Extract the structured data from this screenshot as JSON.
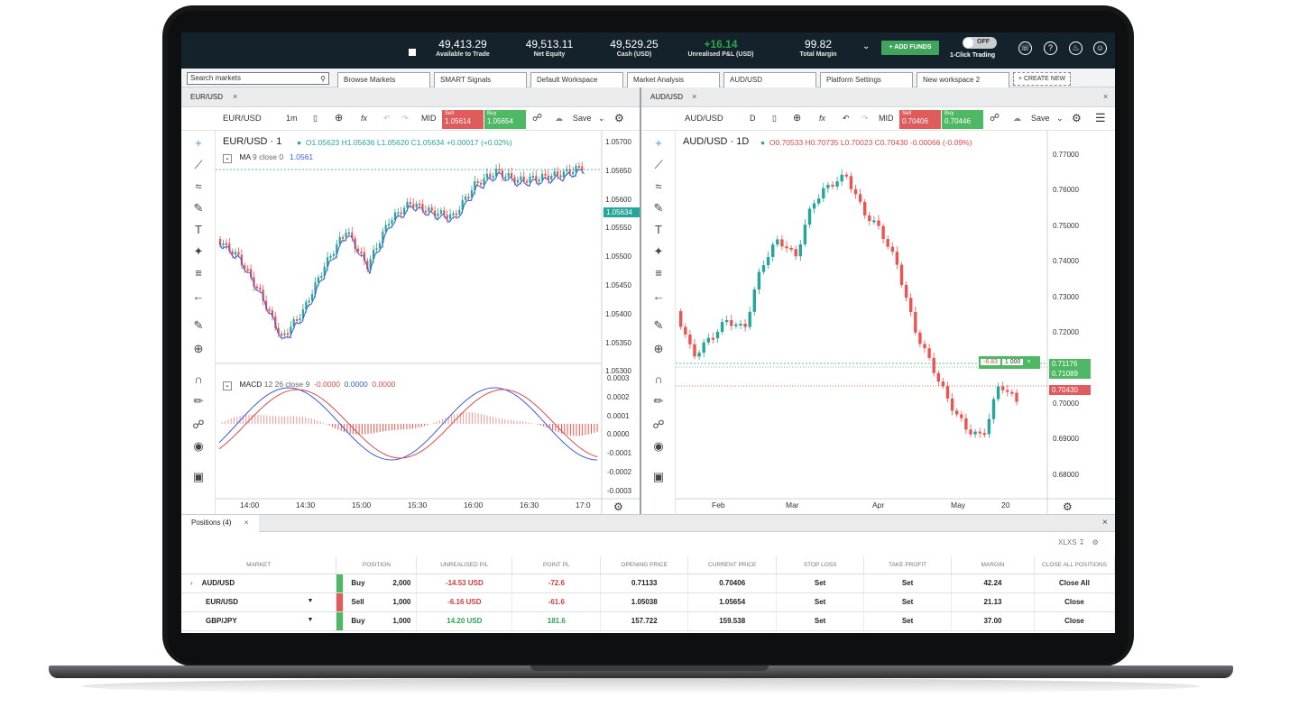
{
  "header": {
    "available_value": "49,413.29",
    "available_label": "Available to Trade",
    "net_value": "49,513.11",
    "net_label": "Net Equity",
    "cash_value": "49,529.25",
    "cash_label": "Cash (USD)",
    "pl_value": "+16.14",
    "pl_label": "Unrealised P&L (USD)",
    "margin_value": "99.82",
    "margin_label": "Total Margin",
    "add_funds": "+ ADD FUNDS",
    "toggle_state": "OFF",
    "toggle_label": "1-Click Trading",
    "icons": [
      "phone-icon",
      "help-icon",
      "bell-icon",
      "user-icon"
    ]
  },
  "workspace": {
    "search_placeholder": "Search markets",
    "tabs": [
      "Browse Markets",
      "SMART Signals",
      "Default Workspace",
      "Market Analysis",
      "AUD/USD",
      "Platform Settings",
      "New workspace 2"
    ],
    "create_new": "+ CREATE NEW"
  },
  "left_chart": {
    "tab": "EUR/USD",
    "toolbar": {
      "symbol": "EUR/USD",
      "interval": "1m",
      "mid": "MID",
      "sell_label": "Sell",
      "sell_price": "1.05614",
      "buy_label": "Buy",
      "buy_price": "1.05654",
      "save": "Save"
    },
    "title": "EUR/USD · 1",
    "o": "O1.05623",
    "h": "H1.05636",
    "l": "L1.05620",
    "c": "C1.05634",
    "chg": "+0.00017 (+0.02%)",
    "ma_label": "MA",
    "ma_params": "9 close 0",
    "ma_value": "1.0561",
    "macd_label": "MACD",
    "macd_params": "12 26 close 9",
    "macd_v1": "-0.0000",
    "macd_v2": "0.0000",
    "macd_v3": "0.0000",
    "y_ticks": [
      "1.05700",
      "1.05650",
      "1.05600",
      "1.05550",
      "1.05500",
      "1.05450",
      "1.05400",
      "1.05350",
      "1.05300"
    ],
    "price_tag": "1.05634",
    "macd_ticks": [
      "0.0003",
      "0.0002",
      "0.0001",
      "0.0000",
      "-0.0001",
      "-0.0002",
      "-0.0003"
    ],
    "x_ticks": [
      "14:00",
      "14:30",
      "15:00",
      "15:30",
      "16:00",
      "16:30",
      "17:0"
    ]
  },
  "right_chart": {
    "tab": "AUD/USD",
    "toolbar": {
      "symbol": "AUD/USD",
      "interval": "D",
      "mid": "MID",
      "sell_label": "Sell",
      "sell_price": "0.70406",
      "buy_label": "Buy",
      "buy_price": "0.70446",
      "save": "Save"
    },
    "title": "AUD/USD · 1D",
    "o": "O0.70533",
    "h": "H0.70735",
    "l": "L0.70023",
    "c": "C0.70430",
    "chg": "-0.00066 (-0.09%)",
    "y_ticks": [
      "0.77000",
      "0.76000",
      "0.75000",
      "0.74000",
      "0.73000",
      "0.72000",
      "0.71000",
      "0.70000",
      "0.69000",
      "0.68000"
    ],
    "tag_green1": "0.71176",
    "tag_green2": "0.71089",
    "tag_red": "0.70430",
    "pos_pl": "-6.83",
    "pos_size": "1 000",
    "x_ticks": [
      "Feb",
      "Mar",
      "Apr",
      "May",
      "20"
    ]
  },
  "positions": {
    "tab": "Positions (4)",
    "export": "XLXS",
    "columns": [
      "MARKET",
      "POSITION",
      "UNREALISED P/L",
      "POINT PL",
      "OPENING PRICE",
      "CURRENT PRICE",
      "STOP LOSS",
      "TAKE PROFIT",
      "MARGIN",
      "CLOSE ALL POSITIONS"
    ],
    "rows": [
      {
        "market": "AUD/USD",
        "side": "Buy",
        "size": "2,000",
        "upl": "-14.53 USD",
        "ppl": "-72.6",
        "open": "0.71133",
        "current": "0.70406",
        "sl": "Set",
        "tp": "Set",
        "margin": "42.24",
        "close": "Close All"
      },
      {
        "market": "EUR/USD",
        "side": "Sell",
        "size": "1,000",
        "upl": "-6.16 USD",
        "ppl": "-61.6",
        "open": "1.05038",
        "current": "1.05654",
        "sl": "Set",
        "tp": "Set",
        "margin": "21.13",
        "close": "Close"
      },
      {
        "market": "GBP/JPY",
        "side": "Buy",
        "size": "1,000",
        "upl": "14.20 USD",
        "ppl": "181.6",
        "open": "157.722",
        "current": "159.538",
        "sl": "Set",
        "tp": "Set",
        "margin": "37.00",
        "close": "Close"
      }
    ]
  },
  "colors": {
    "header_bg": "#14232b",
    "up": "#26a69a",
    "down": "#ef5350",
    "buy": "#4fb865",
    "sell": "#e05b5b",
    "accent": "#3fa55c"
  }
}
